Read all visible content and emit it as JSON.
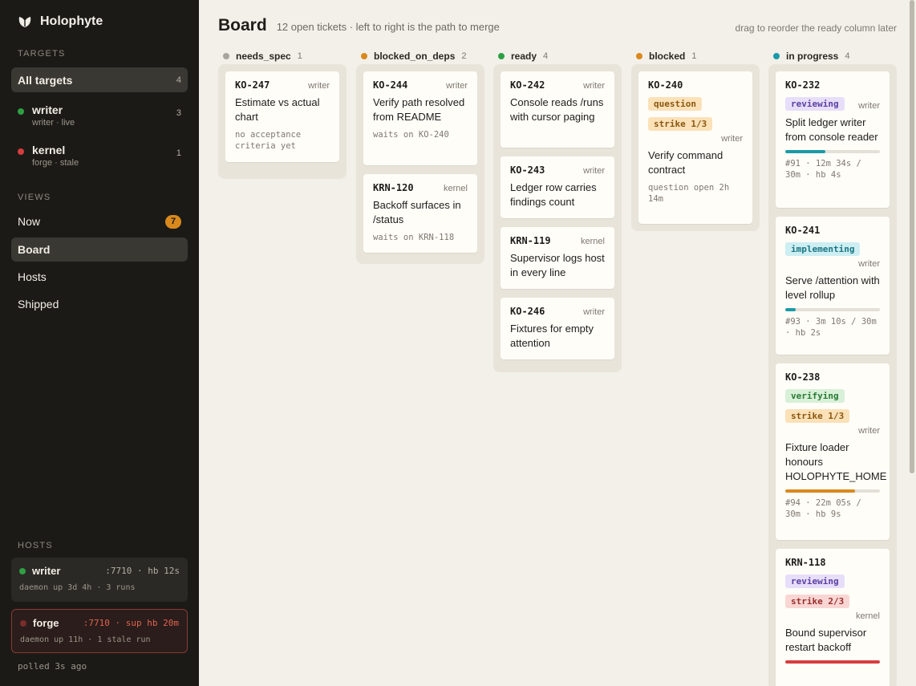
{
  "brand": {
    "name": "Holophyte"
  },
  "sidebar": {
    "targets_label": "TARGETS",
    "all_targets": {
      "label": "All targets",
      "count": "4"
    },
    "targets": [
      {
        "name": "writer",
        "sub": "writer · live",
        "count": "3",
        "status_color": "#2ea043"
      },
      {
        "name": "kernel",
        "sub": "forge · stale",
        "count": "1",
        "status_color": "#d63d3d"
      }
    ],
    "views_label": "VIEWS",
    "views": [
      {
        "label": "Now",
        "badge": "7"
      },
      {
        "label": "Board"
      },
      {
        "label": "Hosts"
      },
      {
        "label": "Shipped"
      }
    ],
    "hosts_label": "HOSTS",
    "hosts": [
      {
        "name": "writer",
        "meta": ":7710 · hb 12s",
        "sub": "daemon up 3d 4h · 3 runs",
        "status_color": "#2ea043"
      },
      {
        "name": "forge",
        "meta": ":7710 · sup hb 20m",
        "sub": "daemon up 11h · 1 stale run",
        "status_color": "#7a2e2a"
      }
    ],
    "polled": "polled 3s ago"
  },
  "header": {
    "title": "Board",
    "subtitle": "12 open tickets · left to right is the path to merge",
    "hint": "drag to reorder the ready column later"
  },
  "columns": [
    {
      "name": "needs_spec",
      "count": "1",
      "color": "#a8a49c",
      "cards": [
        {
          "id": "KO-247",
          "owner": "writer",
          "title": "Estimate vs actual chart",
          "note": "no acceptance criteria yet"
        }
      ]
    },
    {
      "name": "blocked_on_deps",
      "count": "2",
      "color": "#d9891d",
      "cards": [
        {
          "id": "KO-244",
          "owner": "writer",
          "title": "Verify path resolved from README",
          "note": "waits on KO-240"
        },
        {
          "id": "KRN-120",
          "owner": "kernel",
          "title": "Backoff surfaces in /status",
          "note": "waits on KRN-118"
        }
      ]
    },
    {
      "name": "ready",
      "count": "4",
      "color": "#2ea043",
      "cards": [
        {
          "id": "KO-242",
          "owner": "writer",
          "title": "Console reads /runs with cursor paging"
        },
        {
          "id": "KO-243",
          "owner": "writer",
          "title": "Ledger row carries findings count"
        },
        {
          "id": "KRN-119",
          "owner": "kernel",
          "title": "Supervisor logs host in every line"
        },
        {
          "id": "KO-246",
          "owner": "writer",
          "title": "Fixtures for empty attention"
        }
      ]
    },
    {
      "name": "blocked",
      "count": "1",
      "color": "#d9891d",
      "cards": [
        {
          "id": "KO-240",
          "pills": [
            "question",
            "strike 1/3"
          ],
          "owner": "writer",
          "title": "Verify command contract",
          "note": "question open 2h 14m"
        }
      ]
    },
    {
      "name": "in progress",
      "count": "4",
      "color": "#1a9aa8",
      "cards": [
        {
          "id": "KO-232",
          "pill": "reviewing",
          "owner": "writer",
          "title": "Split ledger writer from console reader",
          "progress": 0.42,
          "progress_color": "#1a9aa8",
          "note": "#91 · 12m 34s / 30m · hb 4s"
        },
        {
          "id": "KO-241",
          "pill": "implementing",
          "owner": "writer",
          "title": "Serve /attention with level rollup",
          "progress": 0.11,
          "progress_color": "#1a9aa8",
          "note": "#93 · 3m 10s / 30m · hb 2s"
        },
        {
          "id": "KO-238",
          "pills": [
            "verifying",
            "strike 1/3"
          ],
          "owner": "writer",
          "title": "Fixture loader honours HOLOPHYTE_HOME",
          "progress": 0.74,
          "progress_color": "#d9891d",
          "note": "#94 · 22m 05s / 30m · hb 9s"
        },
        {
          "id": "KRN-118",
          "pills": [
            "reviewing",
            "strike 2/3"
          ],
          "owner": "kernel",
          "title": "Bound supervisor restart backoff",
          "progress": 1.0,
          "progress_color": "#d63d3d"
        }
      ]
    }
  ]
}
